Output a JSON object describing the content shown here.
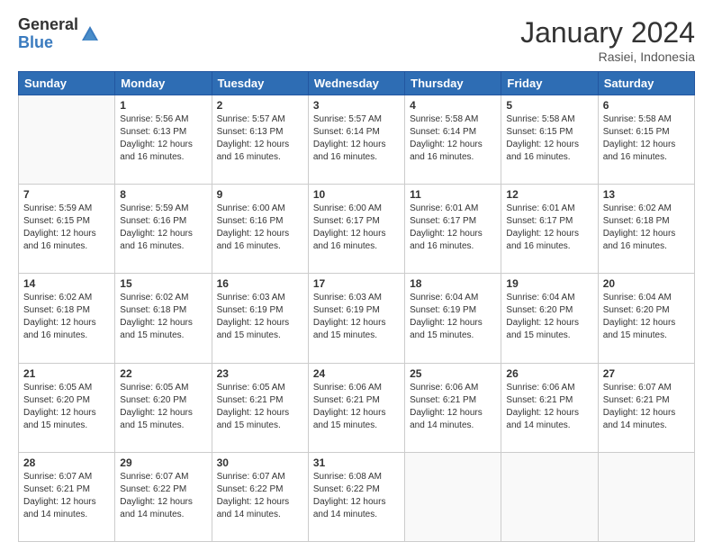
{
  "header": {
    "logo_general": "General",
    "logo_blue": "Blue",
    "month_title": "January 2024",
    "location": "Rasiei, Indonesia"
  },
  "days_of_week": [
    "Sunday",
    "Monday",
    "Tuesday",
    "Wednesday",
    "Thursday",
    "Friday",
    "Saturday"
  ],
  "weeks": [
    [
      {
        "day": "",
        "sunrise": "",
        "sunset": "",
        "daylight": ""
      },
      {
        "day": "1",
        "sunrise": "5:56 AM",
        "sunset": "6:13 PM",
        "daylight": "12 hours and 16 minutes."
      },
      {
        "day": "2",
        "sunrise": "5:57 AM",
        "sunset": "6:13 PM",
        "daylight": "12 hours and 16 minutes."
      },
      {
        "day": "3",
        "sunrise": "5:57 AM",
        "sunset": "6:14 PM",
        "daylight": "12 hours and 16 minutes."
      },
      {
        "day": "4",
        "sunrise": "5:58 AM",
        "sunset": "6:14 PM",
        "daylight": "12 hours and 16 minutes."
      },
      {
        "day": "5",
        "sunrise": "5:58 AM",
        "sunset": "6:15 PM",
        "daylight": "12 hours and 16 minutes."
      },
      {
        "day": "6",
        "sunrise": "5:58 AM",
        "sunset": "6:15 PM",
        "daylight": "12 hours and 16 minutes."
      }
    ],
    [
      {
        "day": "7",
        "sunrise": "5:59 AM",
        "sunset": "6:15 PM",
        "daylight": "12 hours and 16 minutes."
      },
      {
        "day": "8",
        "sunrise": "5:59 AM",
        "sunset": "6:16 PM",
        "daylight": "12 hours and 16 minutes."
      },
      {
        "day": "9",
        "sunrise": "6:00 AM",
        "sunset": "6:16 PM",
        "daylight": "12 hours and 16 minutes."
      },
      {
        "day": "10",
        "sunrise": "6:00 AM",
        "sunset": "6:17 PM",
        "daylight": "12 hours and 16 minutes."
      },
      {
        "day": "11",
        "sunrise": "6:01 AM",
        "sunset": "6:17 PM",
        "daylight": "12 hours and 16 minutes."
      },
      {
        "day": "12",
        "sunrise": "6:01 AM",
        "sunset": "6:17 PM",
        "daylight": "12 hours and 16 minutes."
      },
      {
        "day": "13",
        "sunrise": "6:02 AM",
        "sunset": "6:18 PM",
        "daylight": "12 hours and 16 minutes."
      }
    ],
    [
      {
        "day": "14",
        "sunrise": "6:02 AM",
        "sunset": "6:18 PM",
        "daylight": "12 hours and 16 minutes."
      },
      {
        "day": "15",
        "sunrise": "6:02 AM",
        "sunset": "6:18 PM",
        "daylight": "12 hours and 15 minutes."
      },
      {
        "day": "16",
        "sunrise": "6:03 AM",
        "sunset": "6:19 PM",
        "daylight": "12 hours and 15 minutes."
      },
      {
        "day": "17",
        "sunrise": "6:03 AM",
        "sunset": "6:19 PM",
        "daylight": "12 hours and 15 minutes."
      },
      {
        "day": "18",
        "sunrise": "6:04 AM",
        "sunset": "6:19 PM",
        "daylight": "12 hours and 15 minutes."
      },
      {
        "day": "19",
        "sunrise": "6:04 AM",
        "sunset": "6:20 PM",
        "daylight": "12 hours and 15 minutes."
      },
      {
        "day": "20",
        "sunrise": "6:04 AM",
        "sunset": "6:20 PM",
        "daylight": "12 hours and 15 minutes."
      }
    ],
    [
      {
        "day": "21",
        "sunrise": "6:05 AM",
        "sunset": "6:20 PM",
        "daylight": "12 hours and 15 minutes."
      },
      {
        "day": "22",
        "sunrise": "6:05 AM",
        "sunset": "6:20 PM",
        "daylight": "12 hours and 15 minutes."
      },
      {
        "day": "23",
        "sunrise": "6:05 AM",
        "sunset": "6:21 PM",
        "daylight": "12 hours and 15 minutes."
      },
      {
        "day": "24",
        "sunrise": "6:06 AM",
        "sunset": "6:21 PM",
        "daylight": "12 hours and 15 minutes."
      },
      {
        "day": "25",
        "sunrise": "6:06 AM",
        "sunset": "6:21 PM",
        "daylight": "12 hours and 14 minutes."
      },
      {
        "day": "26",
        "sunrise": "6:06 AM",
        "sunset": "6:21 PM",
        "daylight": "12 hours and 14 minutes."
      },
      {
        "day": "27",
        "sunrise": "6:07 AM",
        "sunset": "6:21 PM",
        "daylight": "12 hours and 14 minutes."
      }
    ],
    [
      {
        "day": "28",
        "sunrise": "6:07 AM",
        "sunset": "6:21 PM",
        "daylight": "12 hours and 14 minutes."
      },
      {
        "day": "29",
        "sunrise": "6:07 AM",
        "sunset": "6:22 PM",
        "daylight": "12 hours and 14 minutes."
      },
      {
        "day": "30",
        "sunrise": "6:07 AM",
        "sunset": "6:22 PM",
        "daylight": "12 hours and 14 minutes."
      },
      {
        "day": "31",
        "sunrise": "6:08 AM",
        "sunset": "6:22 PM",
        "daylight": "12 hours and 14 minutes."
      },
      {
        "day": "",
        "sunrise": "",
        "sunset": "",
        "daylight": ""
      },
      {
        "day": "",
        "sunrise": "",
        "sunset": "",
        "daylight": ""
      },
      {
        "day": "",
        "sunrise": "",
        "sunset": "",
        "daylight": ""
      }
    ]
  ],
  "labels": {
    "sunrise": "Sunrise:",
    "sunset": "Sunset:",
    "daylight": "Daylight:"
  }
}
